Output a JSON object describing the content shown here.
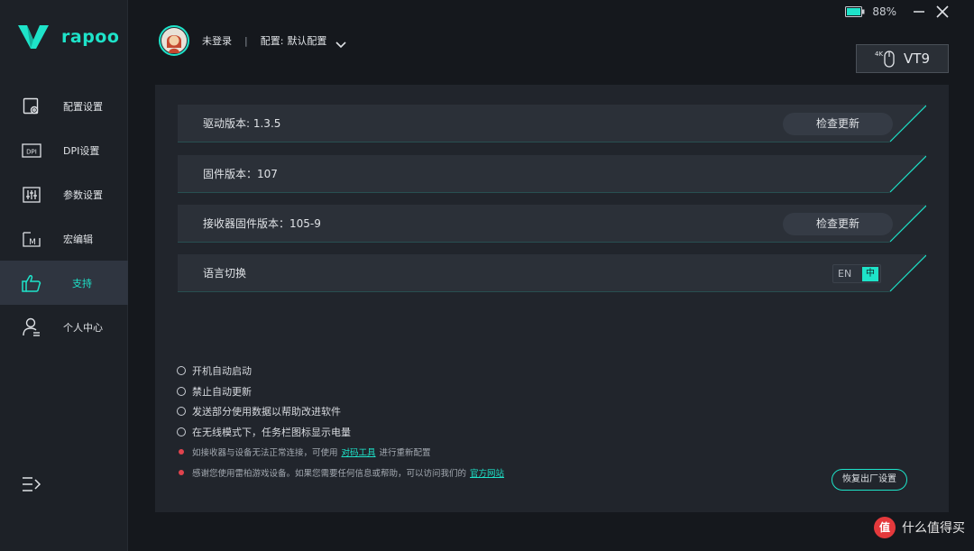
{
  "app": {
    "brand": "rapoo"
  },
  "sidebar": {
    "items": [
      {
        "label": "配置设置",
        "icon": "config-icon"
      },
      {
        "label": "DPI设置",
        "icon": "dpi-icon"
      },
      {
        "label": "参数设置",
        "icon": "sliders-icon"
      },
      {
        "label": "宏编辑",
        "icon": "macro-icon"
      },
      {
        "label": "支持",
        "icon": "thumbs-up-icon",
        "active": true
      },
      {
        "label": "个人中心",
        "icon": "user-icon"
      }
    ],
    "collapse_icon": "menu-collapse-icon"
  },
  "titlebar": {
    "battery": "88%"
  },
  "header": {
    "login_status": "未登录",
    "separator": "|",
    "config_label": "配置:",
    "config_value": "默认配置"
  },
  "device": {
    "badge": "4K",
    "name": "VT9"
  },
  "rows": [
    {
      "label": "驱动版本: 1.3.5",
      "button": "检查更新"
    },
    {
      "label": "固件版本：107"
    },
    {
      "label": "接收器固件版本：105-9",
      "button": "检查更新"
    },
    {
      "label": "语言切换",
      "lang_en": "EN",
      "lang_zh": "中"
    }
  ],
  "options": [
    "开机自动启动",
    "禁止自动更新",
    "发送部分使用数据以帮助改进软件",
    "在无线模式下，任务栏图标显示电量"
  ],
  "notes": [
    {
      "before": "如接收器与设备无法正常连接，可使用",
      "link": "对码工具",
      "after": "进行重新配置"
    },
    {
      "before": "感谢您使用雷柏游戏设备。如果您需要任何信息或帮助，可以访问我们的",
      "link": "官方网站",
      "after": ""
    }
  ],
  "reset_button": "恢复出厂设置",
  "watermark": {
    "badge": "值",
    "text": "什么值得买"
  },
  "colors": {
    "accent": "#1ee3c9",
    "background": "#15181d",
    "panel": "#21252c",
    "sidebar": "#1d2127",
    "alert": "#e0434d"
  }
}
